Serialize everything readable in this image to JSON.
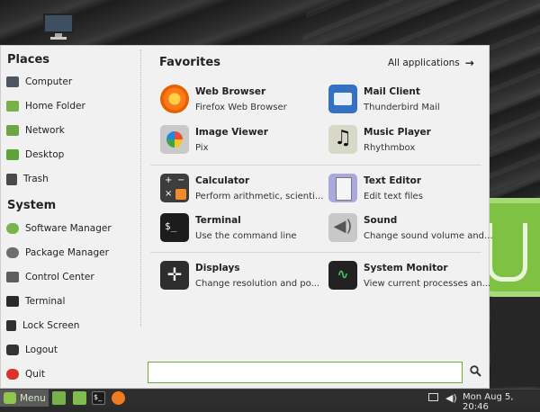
{
  "places": {
    "title": "Places",
    "items": [
      {
        "label": "Computer",
        "icon": "computer-icon"
      },
      {
        "label": "Home Folder",
        "icon": "home-folder-icon"
      },
      {
        "label": "Network",
        "icon": "network-icon"
      },
      {
        "label": "Desktop",
        "icon": "desktop-icon"
      },
      {
        "label": "Trash",
        "icon": "trash-icon"
      }
    ]
  },
  "system": {
    "title": "System",
    "items": [
      {
        "label": "Software Manager",
        "icon": "software-manager-icon"
      },
      {
        "label": "Package Manager",
        "icon": "package-manager-icon"
      },
      {
        "label": "Control Center",
        "icon": "control-center-icon"
      },
      {
        "label": "Terminal",
        "icon": "terminal-icon"
      },
      {
        "label": "Lock Screen",
        "icon": "lock-icon"
      },
      {
        "label": "Logout",
        "icon": "logout-icon"
      },
      {
        "label": "Quit",
        "icon": "power-icon"
      }
    ]
  },
  "favorites": {
    "title": "Favorites",
    "all_apps_label": "All applications",
    "apps": [
      {
        "name": "Web Browser",
        "desc": "Firefox Web Browser",
        "icon": "firefox-icon"
      },
      {
        "name": "Mail Client",
        "desc": "Thunderbird Mail",
        "icon": "mail-icon"
      },
      {
        "name": "Image Viewer",
        "desc": "Pix",
        "icon": "image-viewer-icon"
      },
      {
        "name": "Music Player",
        "desc": "Rhythmbox",
        "icon": "music-icon"
      },
      {
        "name": "Calculator",
        "desc": "Perform arithmetic, scienti...",
        "icon": "calculator-icon"
      },
      {
        "name": "Text Editor",
        "desc": "Edit text files",
        "icon": "text-editor-icon"
      },
      {
        "name": "Terminal",
        "desc": "Use the command line",
        "icon": "terminal-icon"
      },
      {
        "name": "Sound",
        "desc": "Change sound volume and...",
        "icon": "sound-icon"
      },
      {
        "name": "Displays",
        "desc": "Change resolution and po...",
        "icon": "displays-icon"
      },
      {
        "name": "System Monitor",
        "desc": "View current processes an...",
        "icon": "system-monitor-icon"
      }
    ]
  },
  "search": {
    "value": "",
    "icon": "search-icon"
  },
  "taskbar": {
    "menu_label": "Menu",
    "clock": "Mon Aug  5, 20:46",
    "launchers": [
      "file-manager-icon",
      "folder-icon",
      "terminal-icon",
      "firefox-icon"
    ]
  },
  "colors": {
    "accent": "#6faa35",
    "menu_bg": "#f1f1f1",
    "taskbar_bg": "#2e2e2e"
  }
}
